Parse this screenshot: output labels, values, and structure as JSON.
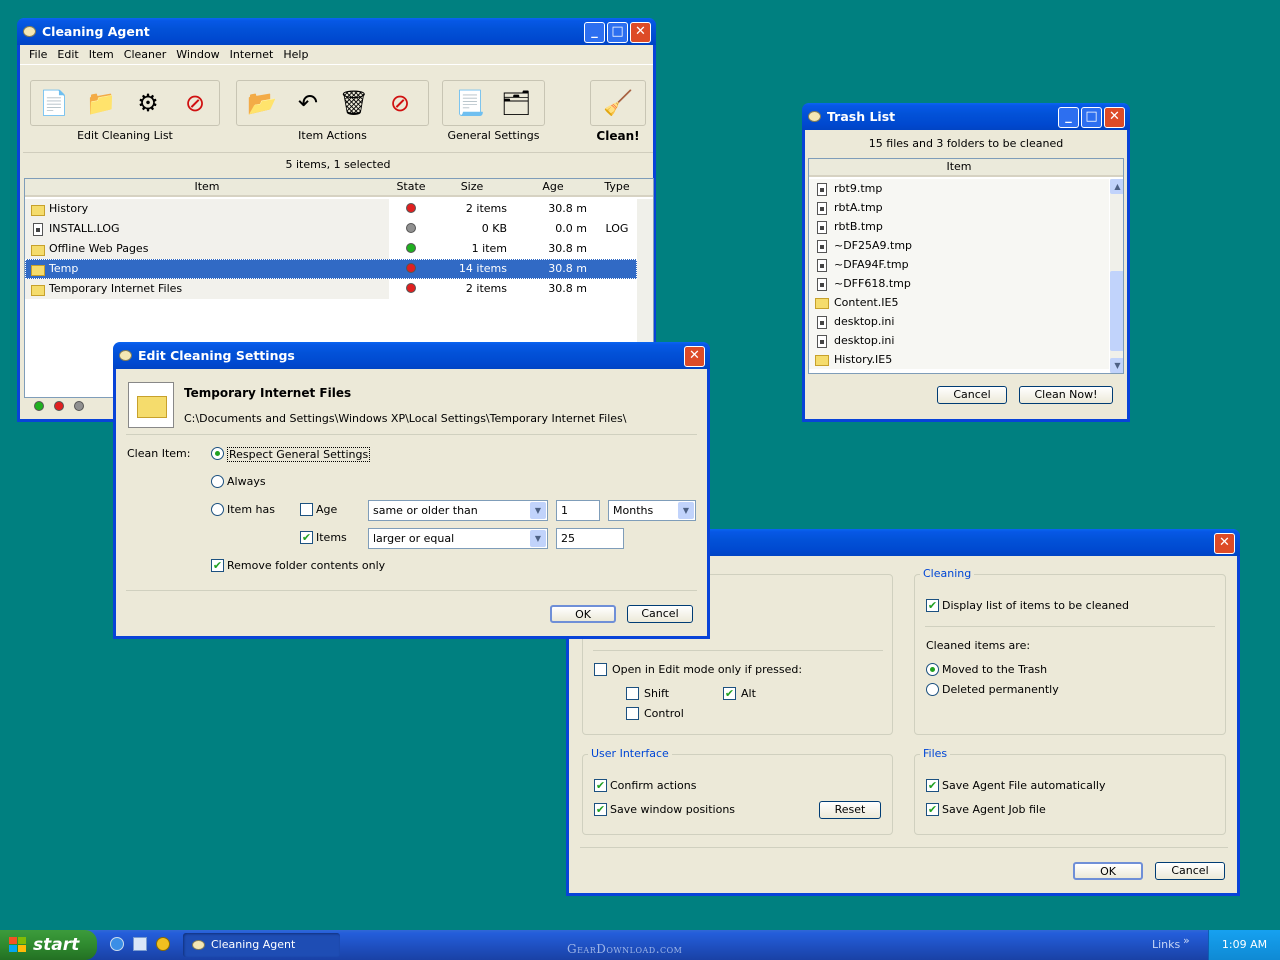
{
  "main_window": {
    "title": "Cleaning Agent",
    "menu": [
      "File",
      "Edit",
      "Item",
      "Cleaner",
      "Window",
      "Internet",
      "Help"
    ],
    "toolbar_groups": {
      "edit_list": "Edit Cleaning List",
      "item_actions": "Item Actions",
      "general_settings": "General Settings",
      "clean": "Clean!"
    },
    "status": "5 items,  1 selected",
    "columns": [
      "Item",
      "State",
      "Size",
      "Age",
      "Type"
    ],
    "rows": [
      {
        "name": "History",
        "state": "red",
        "size": "2 items",
        "age": "30.8 m",
        "type": ""
      },
      {
        "name": "INSTALL.LOG",
        "state": "gray",
        "size": "0 KB",
        "age": "0.0 m",
        "type": "LOG"
      },
      {
        "name": "Offline Web Pages",
        "state": "green",
        "size": "1 item",
        "age": "30.8 m",
        "type": ""
      },
      {
        "name": "Temp",
        "state": "red",
        "size": "14 items",
        "age": "30.8 m",
        "type": ""
      },
      {
        "name": "Temporary Internet Files",
        "state": "red",
        "size": "2 items",
        "age": "30.8 m",
        "type": ""
      }
    ]
  },
  "trash_window": {
    "title": "Trash List",
    "summary": "15 files and 3 folders to be cleaned",
    "column": "Item",
    "items": [
      {
        "name": "rbt9.tmp",
        "kind": "file"
      },
      {
        "name": "rbtA.tmp",
        "kind": "file"
      },
      {
        "name": "rbtB.tmp",
        "kind": "file"
      },
      {
        "name": "~DF25A9.tmp",
        "kind": "file"
      },
      {
        "name": "~DFA94F.tmp",
        "kind": "file"
      },
      {
        "name": "~DFF618.tmp",
        "kind": "file"
      },
      {
        "name": "Content.IE5",
        "kind": "folder"
      },
      {
        "name": "desktop.ini",
        "kind": "file"
      },
      {
        "name": "desktop.ini",
        "kind": "file"
      },
      {
        "name": "History.IE5",
        "kind": "folder"
      }
    ],
    "cancel": "Cancel",
    "clean_now": "Clean Now!"
  },
  "edit_dialog": {
    "title": "Edit Cleaning Settings",
    "item_name": "Temporary Internet Files",
    "item_path": "C:\\Documents and Settings\\Windows XP\\Local Settings\\Temporary Internet Files\\",
    "clean_item_label": "Clean Item:",
    "opt_respect": "Respect General Settings",
    "opt_always": "Always",
    "opt_item_has": "Item has",
    "age_label": "Age",
    "age_condition": "same or older than",
    "age_value": "1",
    "age_unit": "Months",
    "items_label": "Items",
    "items_condition": "larger or equal",
    "items_value": "25",
    "remove_contents": "Remove folder contents only",
    "ok": "OK",
    "cancel": "Cancel"
  },
  "general_dialog": {
    "open_edit_label": "Open in Edit mode only if pressed:",
    "shift": "Shift",
    "alt": "Alt",
    "control": "Control",
    "cleaning_title": "Cleaning",
    "display_list": "Display list of items to be cleaned",
    "cleaned_items_are": "Cleaned items are:",
    "moved_trash": "Moved to the Trash",
    "deleted_perm": "Deleted permanently",
    "ui_title": "User Interface",
    "confirm_actions": "Confirm actions",
    "save_positions": "Save window positions",
    "reset": "Reset",
    "files_title": "Files",
    "save_agent_file": "Save Agent File automatically",
    "save_job_file": "Save Agent Job file",
    "ok": "OK",
    "cancel": "Cancel"
  },
  "taskbar": {
    "start": "start",
    "task": "Cleaning Agent",
    "watermark": "GearDownload.com",
    "links": "Links",
    "clock": "1:09 AM"
  }
}
